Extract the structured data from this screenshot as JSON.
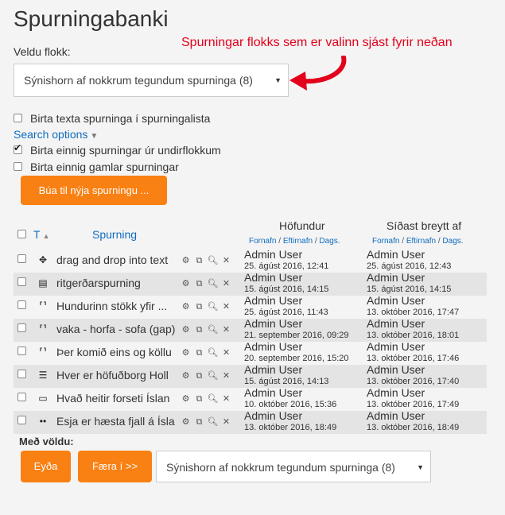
{
  "page": {
    "title": "Spurningabanki"
  },
  "category": {
    "label": "Veldu flokk:",
    "selected": "Sýnishorn af nokkrum tegundum spurninga (8)",
    "annotation": "Spurningar flokks sem er valinn sjást fyrir neðan"
  },
  "options": {
    "show_text": {
      "label": "Birta texta spurninga í spurningalista",
      "checked": false
    },
    "search_options": "Search options",
    "subcategories": {
      "label": "Birta einnig spurningar úr undirflokkum",
      "checked": true
    },
    "old_questions": {
      "label": "Birta einnig gamlar spurningar",
      "checked": false
    }
  },
  "create_button": "Búa til nýja spurningu ...",
  "table": {
    "headers": {
      "type": "T",
      "question": "Spurning",
      "author": "Höfundur",
      "modified": "Síðast breytt af",
      "sort_first": "Fornafn",
      "sort_sep1": " / ",
      "sort_last": "Eftirnafn",
      "sort_sep2": " / ",
      "sort_date": "Dags."
    },
    "rows": [
      {
        "icon": "✥",
        "name": "drag and drop into text",
        "author": "Admin User",
        "author_date": "25. ágúst 2016, 12:41",
        "modifier": "Admin User",
        "modified_date": "25. ágúst 2016, 12:43"
      },
      {
        "icon": "▤",
        "name": "ritgerðarspurning",
        "author": "Admin User",
        "author_date": "15. ágúst 2016, 14:15",
        "modifier": "Admin User",
        "modified_date": "15. ágúst 2016, 14:15"
      },
      {
        "icon": "⸢⸣",
        "name": "Hundurinn stökk yfir ...",
        "author": "Admin User",
        "author_date": "25. ágúst 2016, 11:43",
        "modifier": "Admin User",
        "modified_date": "13. október 2016, 17:47"
      },
      {
        "icon": "⸢⸣",
        "name": "vaka - horfa - sofa (gap)",
        "author": "Admin User",
        "author_date": "21. september 2016, 09:29",
        "modifier": "Admin User",
        "modified_date": "13. október 2016, 18:01"
      },
      {
        "icon": "⸢⸣",
        "name": "Þer komið eins og köllu",
        "author": "Admin User",
        "author_date": "20. september 2016, 15:20",
        "modifier": "Admin User",
        "modified_date": "13. október 2016, 17:46"
      },
      {
        "icon": "☰",
        "name": "Hver er höfuðborg Holl",
        "author": "Admin User",
        "author_date": "15. ágúst 2016, 14:13",
        "modifier": "Admin User",
        "modified_date": "13. október 2016, 17:40"
      },
      {
        "icon": "▭",
        "name": "Hvað heitir forseti Íslan",
        "author": "Admin User",
        "author_date": "10. október 2016, 15:36",
        "modifier": "Admin User",
        "modified_date": "13. október 2016, 17:49"
      },
      {
        "icon": "••",
        "name": "Esja er hæsta fjall á Ísla",
        "author": "Admin User",
        "author_date": "13. október 2016, 18:49",
        "modifier": "Admin User",
        "modified_date": "13. október 2016, 18:49"
      }
    ]
  },
  "bulk": {
    "label": "Með völdu:",
    "delete": "Eyða",
    "move": "Færa í >>",
    "target_category": "Sýnishorn af nokkrum tegundum spurninga (8)"
  },
  "colors": {
    "accent": "#f98012",
    "link": "#0f6cbf",
    "annotation": "#e3001b"
  }
}
